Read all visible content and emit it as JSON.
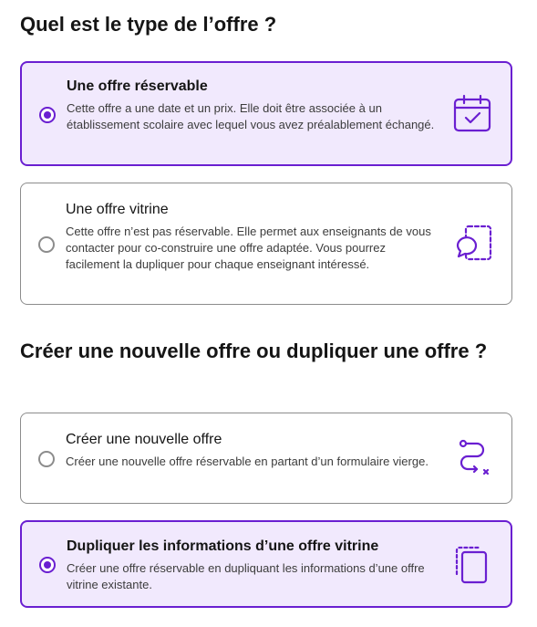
{
  "offer_type": {
    "title": "Quel est le type de l’offre ?",
    "options": [
      {
        "label": "Une offre réservable",
        "description": "Cette offre a une date et un prix. Elle doit être associée à un établissement scolaire avec lequel vous avez préalablement échangé.",
        "icon": "calendar-check-icon",
        "selected": true
      },
      {
        "label": "Une offre vitrine",
        "description": "Cette offre n’est pas réservable. Elle permet aux enseignants de vous contacter pour co-construire une offre adaptée. Vous pourrez facilement la dupliquer pour chaque enseignant intéressé.",
        "icon": "chat-bubble-dashed-icon",
        "selected": false
      }
    ]
  },
  "creation_mode": {
    "title": "Créer une nouvelle offre ou dupliquer une offre ?",
    "options": [
      {
        "label": "Créer une nouvelle offre",
        "description": "Créer une nouvelle offre réservable en partant d’un formulaire vierge.",
        "icon": "route-path-icon",
        "selected": false
      },
      {
        "label": "Dupliquer les informations d’une offre vitrine",
        "description": "Créer une offre réservable en dupliquant les informations d’une offre vitrine existante.",
        "icon": "duplicate-icon",
        "selected": true
      }
    ]
  },
  "colors": {
    "accent": "#6a1fd1",
    "selected_background": "#f1e9fd",
    "border": "#8c8c8c",
    "text": "#151515"
  }
}
